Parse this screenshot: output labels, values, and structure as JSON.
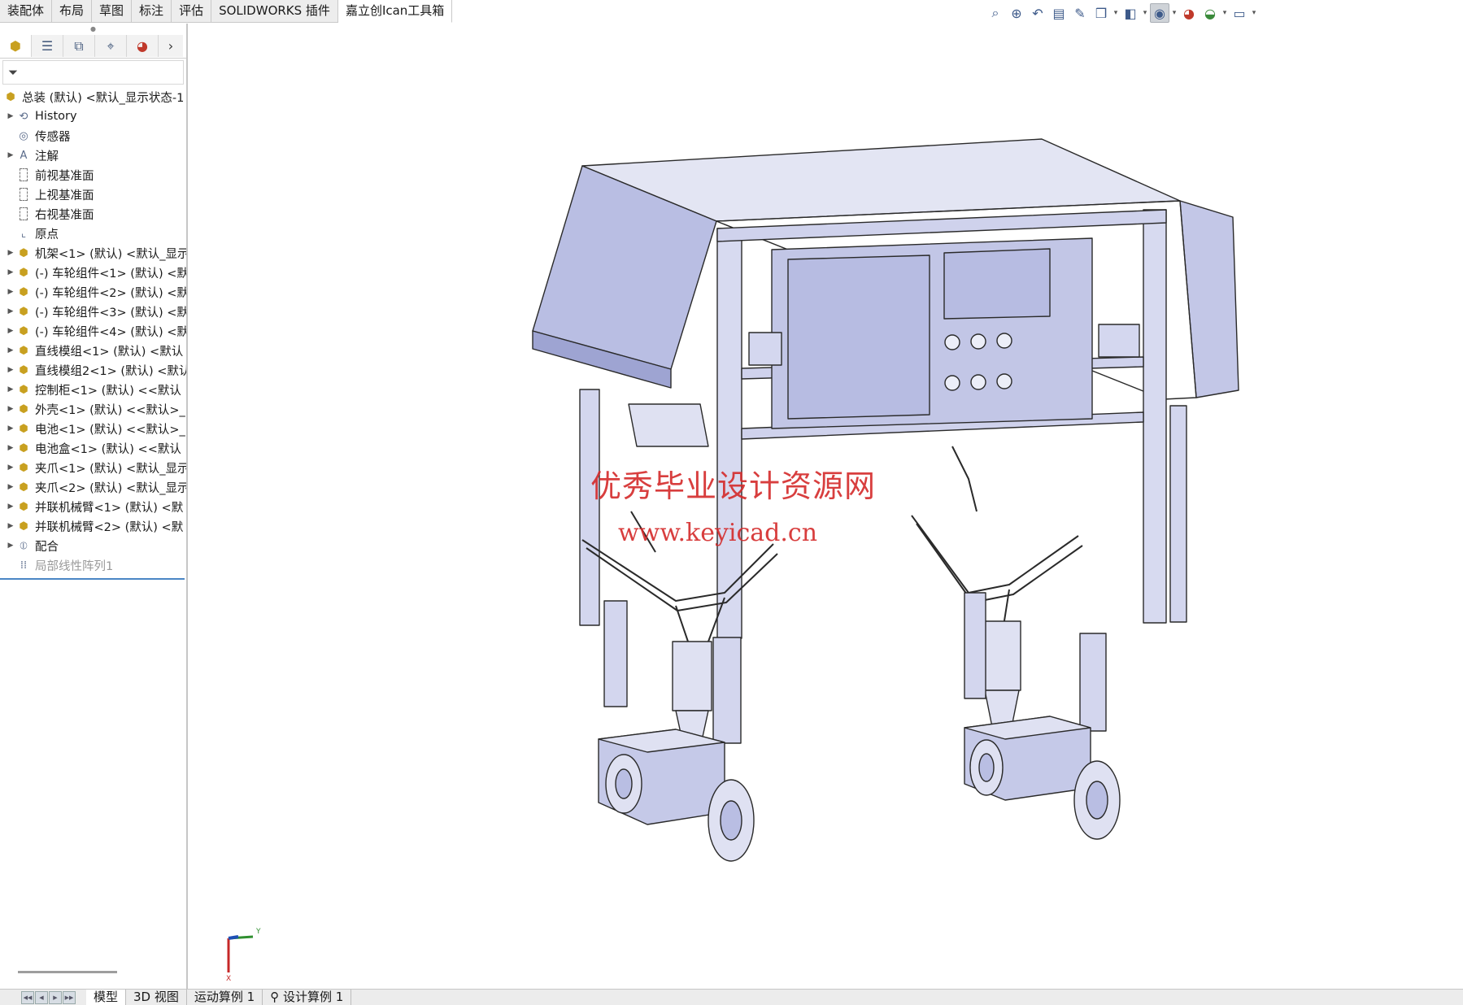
{
  "command_tabs": [
    "装配体",
    "布局",
    "草图",
    "标注",
    "评估",
    "SOLIDWORKS 插件",
    "嘉立创Ican工具箱"
  ],
  "active_command_tab": "嘉立创Ican工具箱",
  "heads_up_toolbar": {
    "icons": [
      "zoom-to-fit-icon",
      "zoom-to-area-icon",
      "previous-view-icon",
      "section-view-icon",
      "dynamic-annotation-icon",
      "view-orientation-icon",
      "display-style-icon",
      "hide-show-items-icon",
      "edit-appearance-icon",
      "apply-scene-icon",
      "view-settings-icon"
    ]
  },
  "manager_tabs": [
    "feature-manager-icon",
    "property-manager-icon",
    "configuration-manager-icon",
    "dimxpert-manager-icon",
    "display-manager-icon"
  ],
  "feature_tree": {
    "root": "总装 (默认) <默认_显示状态-1",
    "items": [
      {
        "label": "History",
        "icon": "history-icon",
        "expandable": true
      },
      {
        "label": "传感器",
        "icon": "sensor-icon",
        "expandable": false
      },
      {
        "label": "注解",
        "icon": "annotation-icon",
        "expandable": true
      },
      {
        "label": "前视基准面",
        "icon": "plane-icon",
        "expandable": false
      },
      {
        "label": "上视基准面",
        "icon": "plane-icon",
        "expandable": false
      },
      {
        "label": "右视基准面",
        "icon": "plane-icon",
        "expandable": false
      },
      {
        "label": "原点",
        "icon": "origin-icon",
        "expandable": false
      },
      {
        "label": "机架<1> (默认) <默认_显示",
        "icon": "assembly-icon",
        "expandable": true
      },
      {
        "label": "(-) 车轮组件<1> (默认) <默",
        "icon": "assembly-icon",
        "expandable": true
      },
      {
        "label": "(-) 车轮组件<2> (默认) <默",
        "icon": "assembly-icon",
        "expandable": true
      },
      {
        "label": "(-) 车轮组件<3> (默认) <默",
        "icon": "assembly-icon",
        "expandable": true
      },
      {
        "label": "(-) 车轮组件<4> (默认) <默",
        "icon": "assembly-icon",
        "expandable": true
      },
      {
        "label": "直线模组<1> (默认) <默认",
        "icon": "assembly-icon",
        "expandable": true
      },
      {
        "label": "直线模组2<1> (默认) <默认",
        "icon": "assembly-icon",
        "expandable": true
      },
      {
        "label": "控制柜<1> (默认) <<默认",
        "icon": "part-icon",
        "expandable": true
      },
      {
        "label": "外壳<1> (默认) <<默认>_",
        "icon": "part-icon",
        "expandable": true
      },
      {
        "label": "电池<1> (默认) <<默认>_",
        "icon": "part-icon",
        "expandable": true
      },
      {
        "label": "电池盒<1> (默认) <<默认",
        "icon": "part-icon",
        "expandable": true
      },
      {
        "label": "夹爪<1> (默认) <默认_显示",
        "icon": "assembly-icon",
        "expandable": true
      },
      {
        "label": "夹爪<2> (默认) <默认_显示",
        "icon": "assembly-icon",
        "expandable": true
      },
      {
        "label": "并联机械臂<1> (默认) <默",
        "icon": "assembly-icon",
        "expandable": true
      },
      {
        "label": "并联机械臂<2> (默认) <默",
        "icon": "assembly-icon",
        "expandable": true
      },
      {
        "label": "配合",
        "icon": "mates-icon",
        "expandable": true
      },
      {
        "label": "局部线性阵列1",
        "icon": "linear-pattern-icon",
        "expandable": false,
        "muted": true
      }
    ]
  },
  "watermark": {
    "line1": "优秀毕业设计资源网",
    "line2": "www.keyicad.cn",
    "color": "#d42a2a"
  },
  "triad": {
    "x_label": "X",
    "y_label": "Y"
  },
  "bottom_tabs": [
    "模型",
    "3D 视图",
    "运动算例 1",
    "设计算例 1"
  ],
  "active_bottom_tab": "模型",
  "colors": {
    "model_fill": "#c9cde8",
    "model_edge": "#2a2a2a",
    "tree_end_line": "#4a86c5"
  }
}
